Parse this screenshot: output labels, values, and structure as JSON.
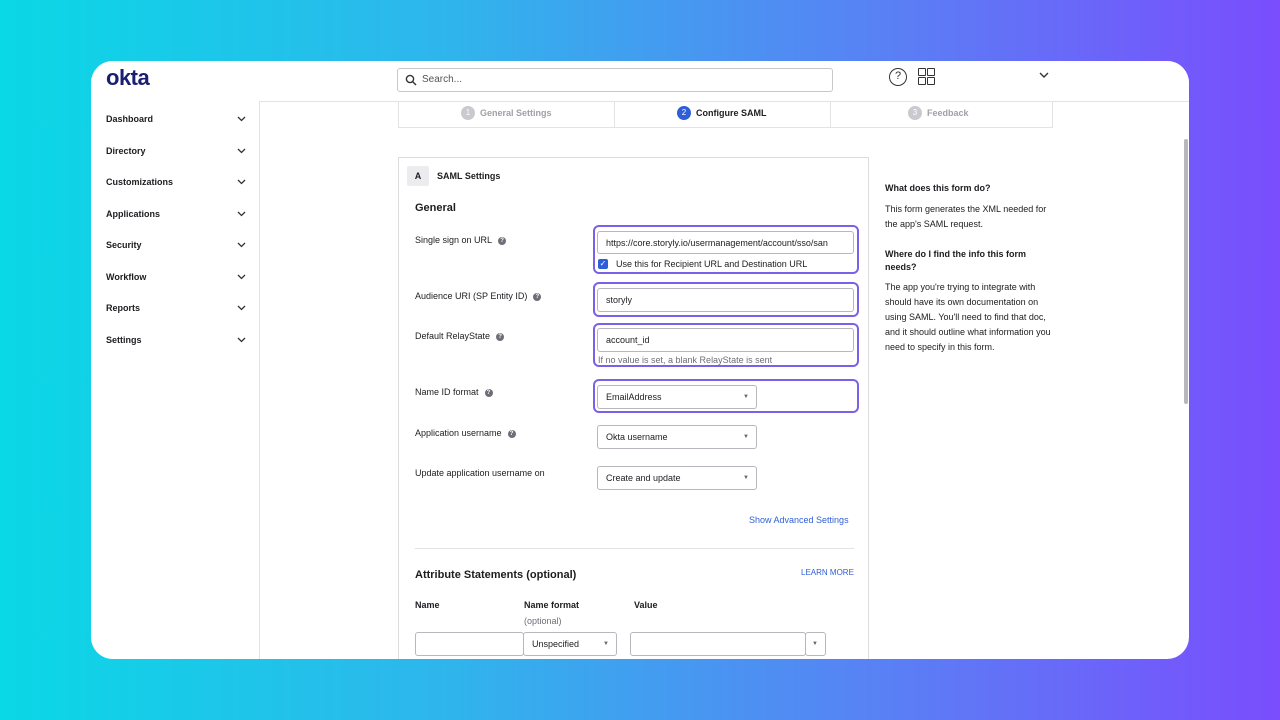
{
  "brand": {
    "logo": "okta"
  },
  "topbar": {
    "search_placeholder": "Search...",
    "help_glyph": "?"
  },
  "sidebar": {
    "items": [
      {
        "label": "Dashboard"
      },
      {
        "label": "Directory"
      },
      {
        "label": "Customizations"
      },
      {
        "label": "Applications"
      },
      {
        "label": "Security"
      },
      {
        "label": "Workflow"
      },
      {
        "label": "Reports"
      },
      {
        "label": "Settings"
      }
    ]
  },
  "wizard": {
    "steps": [
      {
        "num": "1",
        "label": "General Settings",
        "state": "done"
      },
      {
        "num": "2",
        "label": "Configure SAML",
        "state": "active"
      },
      {
        "num": "3",
        "label": "Feedback",
        "state": "pending"
      }
    ]
  },
  "panel": {
    "badge": "A",
    "title": "SAML Settings",
    "general_heading": "General",
    "sso_url": {
      "label": "Single sign on URL",
      "value": "https://core.storyly.io/usermanagement/account/sso/san",
      "checkbox_label": "Use this for Recipient URL and Destination URL",
      "checked": true
    },
    "audience_uri": {
      "label": "Audience URI (SP Entity ID)",
      "value": "storyly"
    },
    "relay_state": {
      "label": "Default RelayState",
      "value": "account_id",
      "hint": "If no value is set, a blank RelayState is sent"
    },
    "name_id_format": {
      "label": "Name ID format",
      "value": "EmailAddress"
    },
    "app_username": {
      "label": "Application username",
      "value": "Okta username"
    },
    "update_username": {
      "label": "Update application username on",
      "value": "Create and update"
    },
    "advanced_link": "Show Advanced Settings",
    "attributes": {
      "heading": "Attribute Statements (optional)",
      "learn_more": "LEARN MORE",
      "col_name": "Name",
      "col_format": "Name format",
      "col_format_sub": "(optional)",
      "col_value": "Value",
      "row_format": "Unspecified"
    }
  },
  "help": {
    "q1": "What does this form do?",
    "a1": "This form generates the XML needed for the app's SAML request.",
    "q2": "Where do I find the info this form needs?",
    "a2": "The app you're trying to integrate with should have its own documentation on using SAML. You'll need to find that doc, and it should outline what information you need to specify in this form."
  },
  "colors": {
    "brand": "#1a1f71",
    "accent": "#2f5fd8",
    "highlight": "#7b61e8"
  }
}
